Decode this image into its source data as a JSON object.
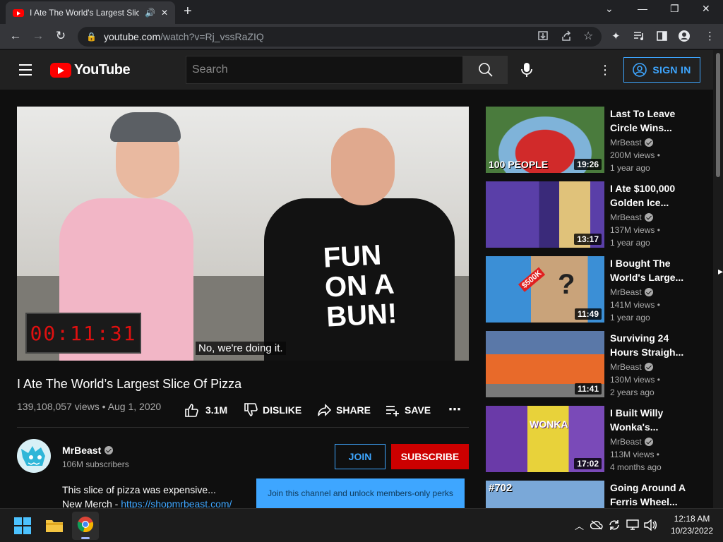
{
  "browser": {
    "tab_title": "I Ate The World's Largest Slic",
    "url_host": "youtube.com",
    "url_path": "/watch?v=Rj_vssRaZIQ"
  },
  "header": {
    "logo_text": "YouTube",
    "search_placeholder": "Search",
    "signin_label": "SIGN IN"
  },
  "player": {
    "counter": "00:11:31",
    "caption": "No, we're doing it.",
    "shirt_text": "FUN ON A BUN!"
  },
  "video": {
    "title": "I Ate The World’s Largest Slice Of Pizza",
    "views": "139,108,057 views",
    "date": "Aug 1, 2020",
    "likes": "3.1M",
    "dislike_label": "DISLIKE",
    "share_label": "SHARE",
    "save_label": "SAVE"
  },
  "channel": {
    "name": "MrBeast",
    "subscribers": "106M subscribers",
    "join_label": "JOIN",
    "subscribe_label": "SUBSCRIBE",
    "join_tooltip": "Join this channel and unlock members-only perks",
    "desc_line1": "This slice of pizza was expensive...",
    "desc_merch_prefix": "New Merch - ",
    "desc_merch_link": "https://shopmrbeast.com/"
  },
  "recommendations": [
    {
      "title_l1": "Last To Leave",
      "title_l2": "Circle Wins...",
      "channel": "MrBeast",
      "views": "200M views •",
      "age": "1 year ago",
      "duration": "19:26",
      "overlay": "100 PEOPLE"
    },
    {
      "title_l1": "I Ate $100,000",
      "title_l2": "Golden Ice...",
      "channel": "MrBeast",
      "views": "137M views •",
      "age": "1 year ago",
      "duration": "13:17",
      "overlay": ""
    },
    {
      "title_l1": "I Bought The",
      "title_l2": "World's Large...",
      "channel": "MrBeast",
      "views": "141M views •",
      "age": "1 year ago",
      "duration": "11:49",
      "overlay": "$500K"
    },
    {
      "title_l1": "Surviving 24",
      "title_l2": "Hours Straigh...",
      "channel": "MrBeast",
      "views": "130M views •",
      "age": "2 years ago",
      "duration": "11:41",
      "overlay": ""
    },
    {
      "title_l1": "I Built Willy",
      "title_l2": "Wonka's...",
      "channel": "MrBeast",
      "views": "113M views •",
      "age": "4 months ago",
      "duration": "17:02",
      "overlay": "WONKA"
    },
    {
      "title_l1": "Going Around A",
      "title_l2": "Ferris Wheel...",
      "channel": "",
      "views": "",
      "age": "",
      "duration": "",
      "overlay": "#702"
    }
  ],
  "taskbar": {
    "time": "12:18 AM",
    "date": "10/23/2022"
  }
}
